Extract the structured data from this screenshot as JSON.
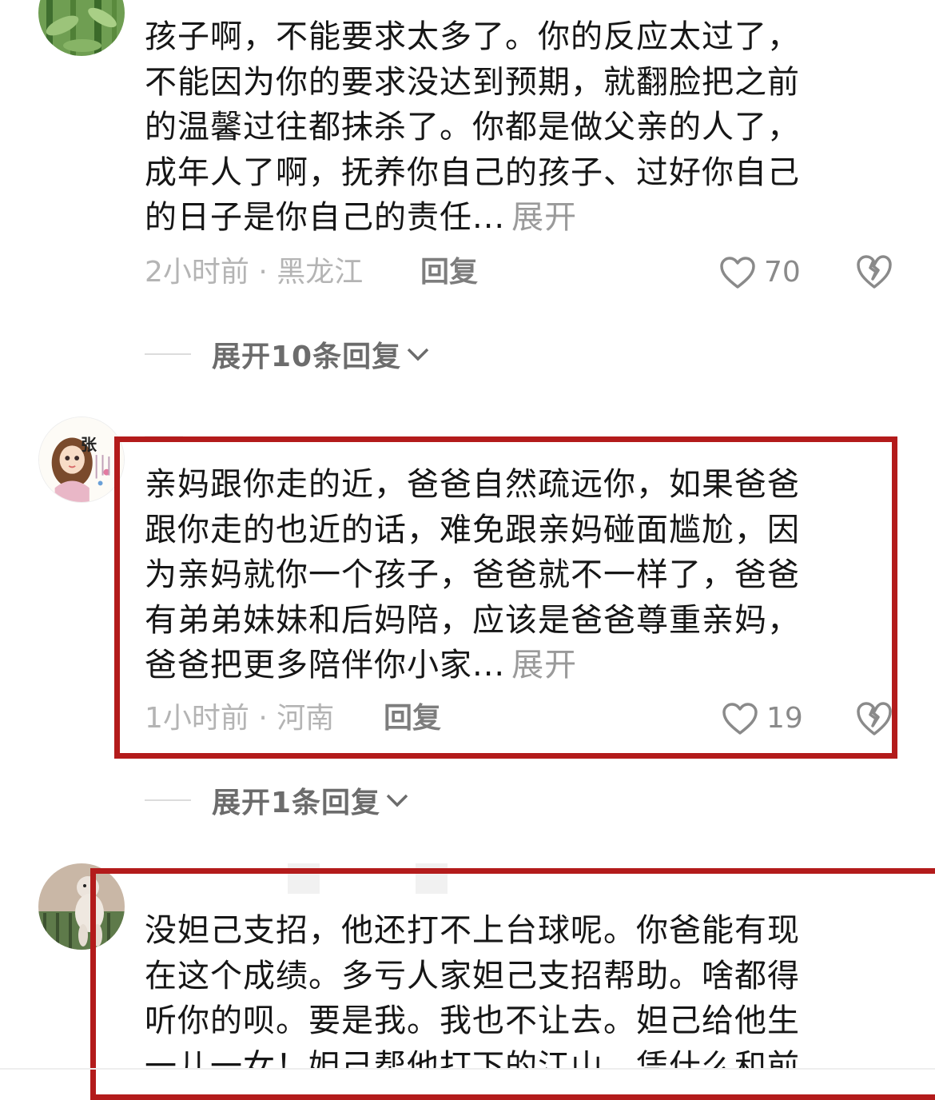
{
  "comments": [
    {
      "avatar": "bamboo-avatar",
      "lines": [
        "孩子啊，不能要求太多了。你的反应太过了，",
        "不能因为你的要求没达到预期，就翻脸把之前",
        "的温馨过往都抹杀了。你都是做父亲的人了，",
        "成年人了啊，抚养你自己的孩子、过好你自己",
        "的日子是你自己的责任..."
      ],
      "expand_label": "展开",
      "meta": "2小时前 · 黑龙江",
      "reply_label": "回复",
      "likes": "70",
      "more_replies": "展开10条回复"
    },
    {
      "avatar": "girl-illustration-avatar",
      "avatar_text": "张",
      "lines": [
        "亲妈跟你走的近，爸爸自然疏远你，如果爸爸",
        "跟你走的也近的话，难免跟亲妈碰面尴尬，因",
        "为亲妈就你一个孩子，爸爸就不一样了，爸爸",
        "有弟弟妹妹和后妈陪，应该是爸爸尊重亲妈，",
        "爸爸把更多陪伴你小家..."
      ],
      "expand_label": "展开",
      "meta": "1小时前 · 河南",
      "reply_label": "回复",
      "likes": "19",
      "more_replies": "展开1条回复"
    },
    {
      "avatar": "poodle-avatar",
      "lines": [
        "没妲己支招，他还打不上台球呢。你爸能有现",
        "在这个成绩。多亏人家妲己支招帮助。啥都得",
        "听你的呗。要是我。我也不让去。妲己给他生",
        "一儿一女！妲己帮他打下的江山。凭什么和前"
      ]
    }
  ],
  "colors": {
    "highlight": "#b31b1b",
    "text": "#161616",
    "meta": "#b4b4b4"
  }
}
